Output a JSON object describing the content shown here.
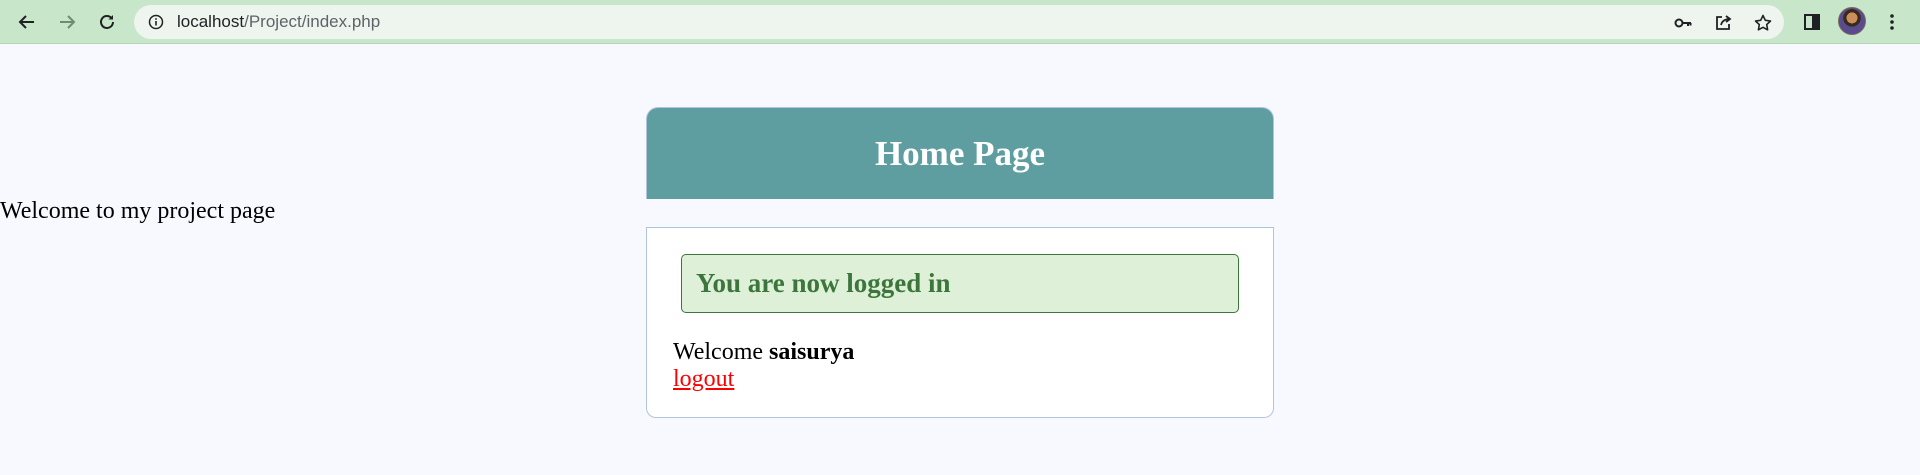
{
  "browser": {
    "url_host": "localhost",
    "url_path": "/Project/index.php",
    "icons": {
      "back": "back-arrow-icon",
      "forward": "forward-arrow-icon",
      "reload": "reload-icon",
      "site_info": "info-icon",
      "password": "key-icon",
      "share": "share-icon",
      "bookmark": "star-icon",
      "side_panel": "side-panel-icon",
      "profile": "avatar",
      "menu": "kebab-menu-icon"
    },
    "colors": {
      "toolbar_bg": "#c8e6c9",
      "omnibox_bg": "#eef5ee"
    }
  },
  "page": {
    "side_text": "Welcome to my project page",
    "header_title": "Home Page",
    "success_message": "You are now logged in",
    "welcome_prefix": "Welcome",
    "username": "saisurya",
    "logout_label": "logout",
    "colors": {
      "background": "#f8f9fe",
      "header_bg": "#5f9ea0",
      "success_bg": "#dff0d8",
      "success_text": "#3c763d",
      "logout_link": "#ff0000"
    }
  }
}
